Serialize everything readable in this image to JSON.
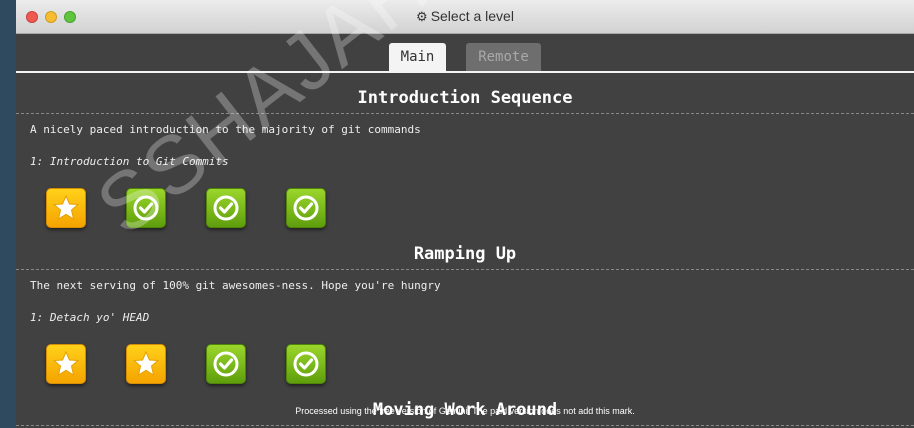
{
  "window": {
    "title": "Select a level",
    "title_icon": "gear-icon"
  },
  "tabs": [
    {
      "label": "Main",
      "active": true
    },
    {
      "label": "Remote",
      "active": false
    }
  ],
  "sections": [
    {
      "title": "Introduction Sequence",
      "description": "A nicely paced introduction to the majority of git commands",
      "current_level": "1: Introduction to Git Commits",
      "levels": [
        "star",
        "check",
        "check",
        "check"
      ]
    },
    {
      "title": "Ramping Up",
      "description": "The next serving of 100% git awesomes-ness. Hope you're hungry",
      "current_level": "1: Detach yo' HEAD",
      "levels": [
        "star",
        "star",
        "check",
        "check"
      ]
    },
    {
      "title": "Moving Work Around"
    }
  ],
  "watermark": "SSHAJAHAN",
  "processing_note": "Processed using the free version of Gemini. The paid version does not add this mark.",
  "colors": {
    "star_level": "#ffc200",
    "completed_level": "#7dbd1c",
    "background": "#414141"
  }
}
